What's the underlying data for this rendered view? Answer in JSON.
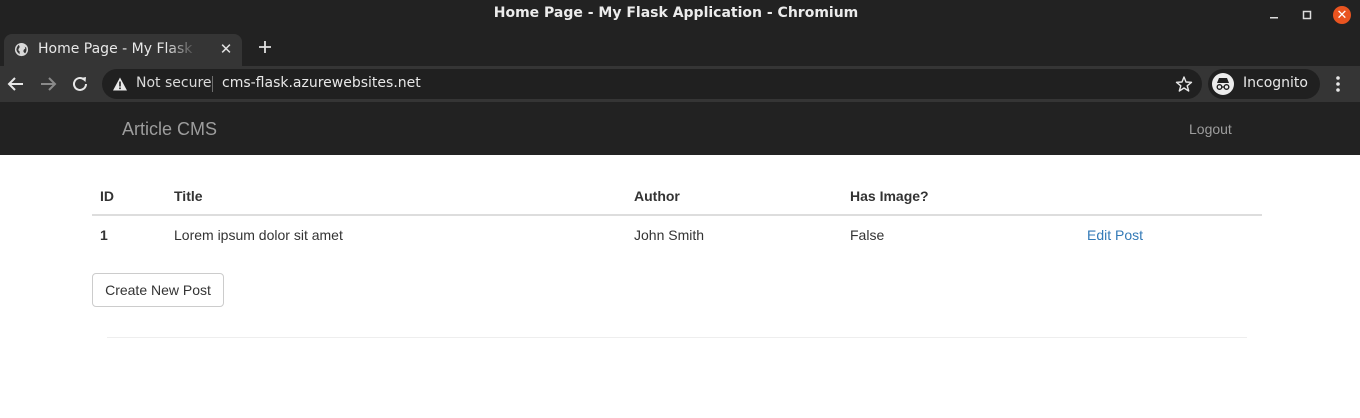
{
  "window": {
    "title": "Home Page - My Flask Application - Chromium"
  },
  "tab": {
    "title": "Home Page - My Flask Application",
    "close_glyph": "✕"
  },
  "toolbar": {
    "security_label": "Not secure",
    "url": "cms-flask.azurewebsites.net",
    "profile_label": "Incognito"
  },
  "page": {
    "brand": "Article CMS",
    "logout_label": "Logout",
    "table": {
      "headers": {
        "id": "ID",
        "title": "Title",
        "author": "Author",
        "has_image": "Has Image?"
      },
      "rows": [
        {
          "id": "1",
          "title": "Lorem ipsum dolor sit amet",
          "author": "John Smith",
          "has_image": "False",
          "action": "Edit Post"
        }
      ]
    },
    "create_button_label": "Create New Post"
  },
  "icons": {
    "favicon": "globe-icon",
    "back": "arrow-left-icon",
    "forward": "arrow-right-icon",
    "reload": "reload-icon",
    "security": "warning-triangle-icon",
    "bookmark": "star-icon",
    "incognito": "incognito-icon",
    "menu": "kebab-menu-icon"
  },
  "colors": {
    "chrome_dark": "#222222",
    "toolbar": "#353535",
    "close_button": "#e95420",
    "link": "#337ab7",
    "navbar_text": "#9d9d9d"
  }
}
